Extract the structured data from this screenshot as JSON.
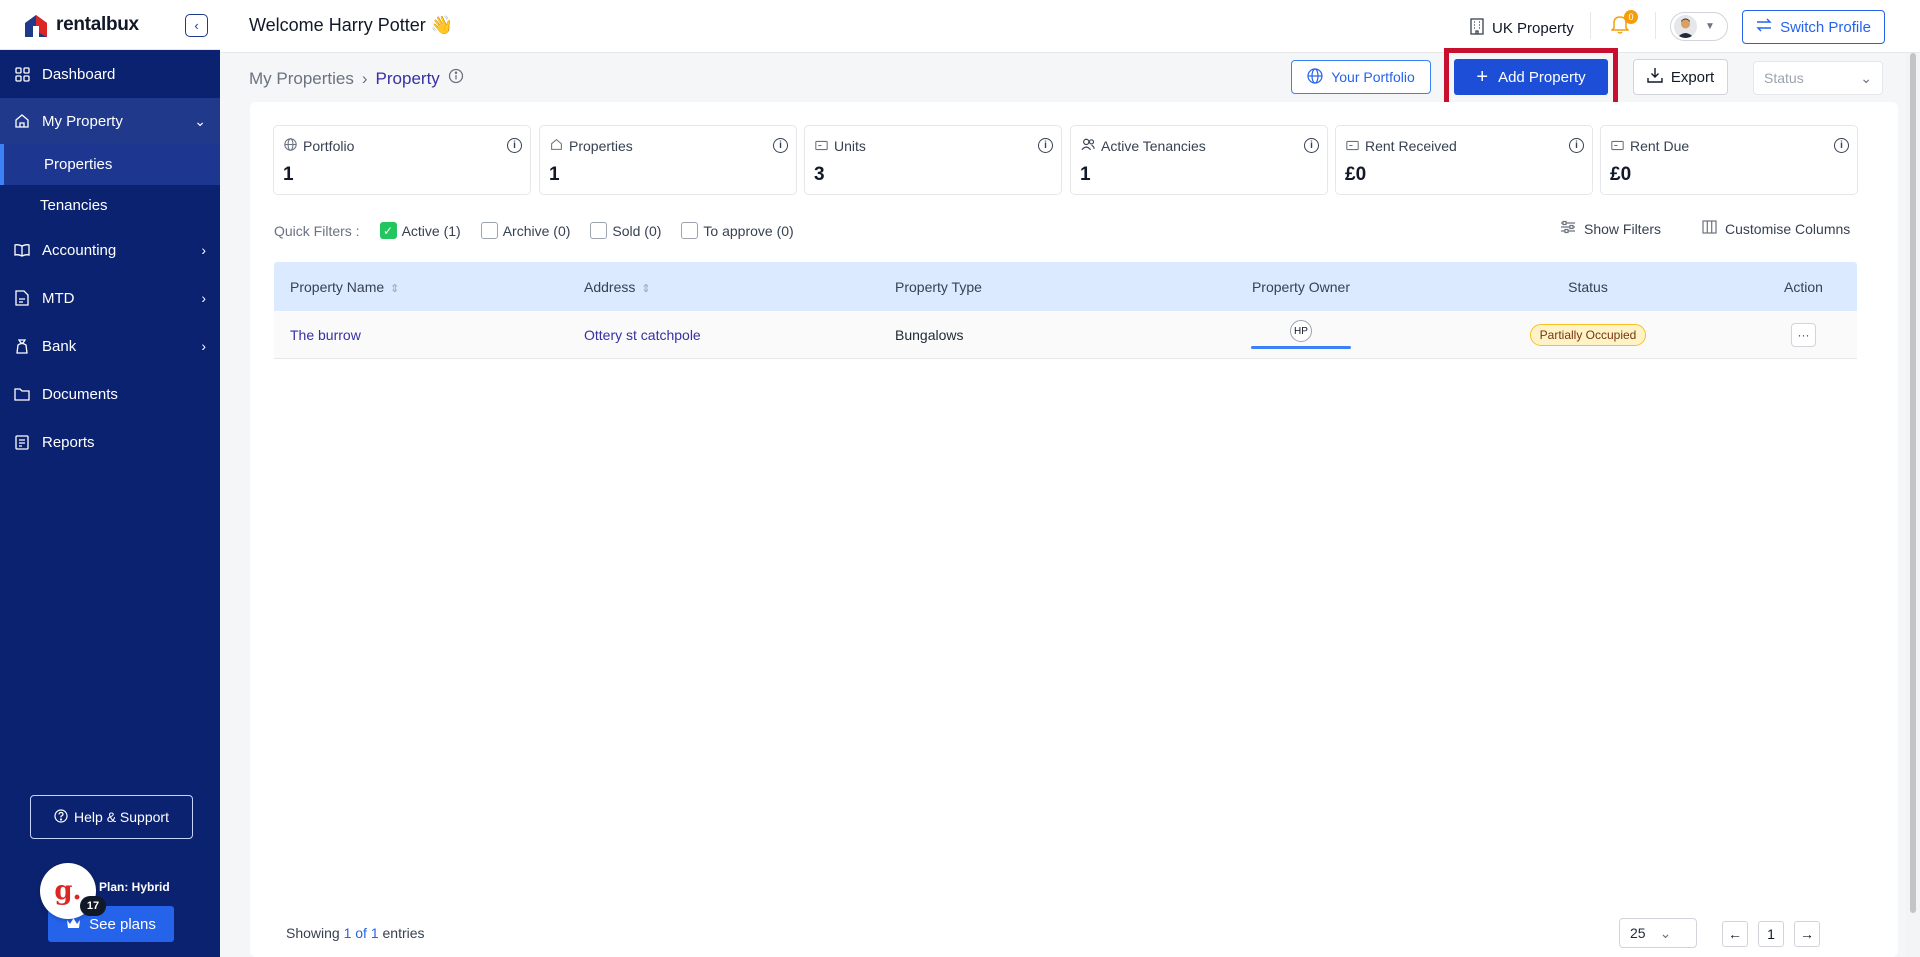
{
  "app": {
    "name": "rentalbux"
  },
  "sidebar": {
    "items": [
      {
        "label": "Dashboard",
        "icon": "grid-icon"
      },
      {
        "label": "My Property",
        "icon": "home-icon"
      },
      {
        "label": "Accounting",
        "icon": "book-icon"
      },
      {
        "label": "MTD",
        "icon": "file-icon"
      },
      {
        "label": "Bank",
        "icon": "bank-icon"
      },
      {
        "label": "Documents",
        "icon": "folder-icon"
      },
      {
        "label": "Reports",
        "icon": "report-icon"
      }
    ],
    "sub_items": [
      {
        "label": "Properties"
      },
      {
        "label": "Tenancies"
      }
    ],
    "help_label": "Help & Support",
    "plan_label": "Plan: Hybrid",
    "see_plans_label": "See plans",
    "g_badge_letter": "g.",
    "g_badge_count": "17"
  },
  "header": {
    "welcome": "Welcome Harry Potter 👋",
    "region": "UK Property",
    "notification_count": "0",
    "switch_profile": "Switch Profile"
  },
  "breadcrumb": {
    "parent": "My Properties",
    "current": "Property"
  },
  "toolbar": {
    "portfolio": "Your Portfolio",
    "add_property": "Add Property",
    "export": "Export",
    "status_placeholder": "Status"
  },
  "stats": [
    {
      "label": "Portfolio",
      "value": "1"
    },
    {
      "label": "Properties",
      "value": "1"
    },
    {
      "label": "Units",
      "value": "3"
    },
    {
      "label": "Active Tenancies",
      "value": "1"
    },
    {
      "label": "Rent Received",
      "value": "£0"
    },
    {
      "label": "Rent Due",
      "value": "£0"
    }
  ],
  "filters": {
    "label": "Quick Filters :",
    "items": [
      {
        "label": "Active (1)",
        "checked": true
      },
      {
        "label": "Archive (0)",
        "checked": false
      },
      {
        "label": "Sold (0)",
        "checked": false
      },
      {
        "label": "To approve (0)",
        "checked": false
      }
    ],
    "show_filters": "Show Filters",
    "customise_columns": "Customise Columns"
  },
  "table": {
    "headers": [
      "Property Name",
      "Address",
      "Property Type",
      "Property Owner",
      "Status",
      "Action"
    ],
    "rows": [
      {
        "name": "The burrow",
        "address": "Ottery st catchpole",
        "type": "Bungalows",
        "owner": "HP",
        "status": "Partially Occupied",
        "action": "···"
      }
    ]
  },
  "footer": {
    "showing_prefix": "Showing ",
    "showing_range": "1 of 1",
    "showing_suffix": " entries",
    "per_page": "25",
    "page": "1",
    "prev": "←",
    "next": "→"
  }
}
